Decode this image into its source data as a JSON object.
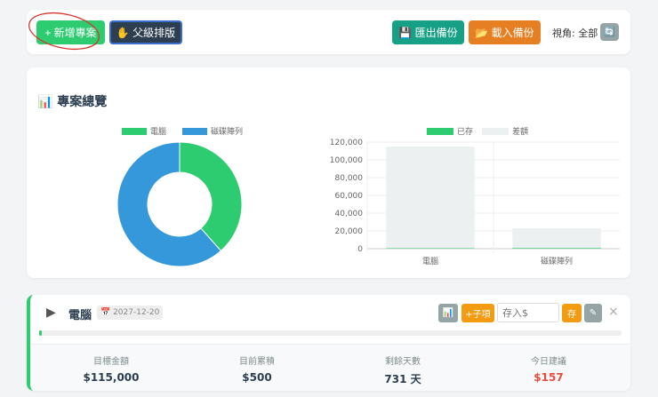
{
  "toolbar": {
    "add_project": "+ 新增專案",
    "parent_layout": "✋ 父級排版",
    "export_backup": "💾 匯出備份",
    "import_backup": "📂 載入備份",
    "view_label": "視角: 全部",
    "refresh_icon": "🔄"
  },
  "overview": {
    "title": "📊 專案總覽"
  },
  "chart_data": [
    {
      "type": "pie",
      "donut": true,
      "labels": [
        "電腦",
        "磁碟陣列"
      ],
      "values": [
        500,
        800
      ],
      "colors": [
        "#2ecc71",
        "#3498db"
      ],
      "legend": "top"
    },
    {
      "type": "bar",
      "stacked": true,
      "categories": [
        "電腦",
        "磁碟陣列"
      ],
      "series": [
        {
          "name": "已存",
          "values": [
            500,
            800
          ],
          "color": "#2ecc71"
        },
        {
          "name": "差額",
          "values": [
            114500,
            22200
          ],
          "color": "#ecf0f1"
        }
      ],
      "ylim": [
        0,
        120000
      ],
      "yticks": [
        "120,000",
        "100,000",
        "80,000",
        "60,000",
        "40,000",
        "20,000",
        "0"
      ],
      "legend": "top"
    }
  ],
  "project": {
    "name": "電腦",
    "date": "📅 2027-12-20",
    "chart_btn": "📊",
    "add_child": "+子項",
    "deposit_placeholder": "存入$",
    "save": "存",
    "edit": "✎",
    "close": "×",
    "progress": 0.0043,
    "stats": [
      {
        "label": "目標金額",
        "value": "$115,000"
      },
      {
        "label": "目前累積",
        "value": "$500"
      },
      {
        "label": "剩餘天數",
        "value": "731 天"
      },
      {
        "label": "今日建議",
        "value": "$157"
      }
    ]
  }
}
